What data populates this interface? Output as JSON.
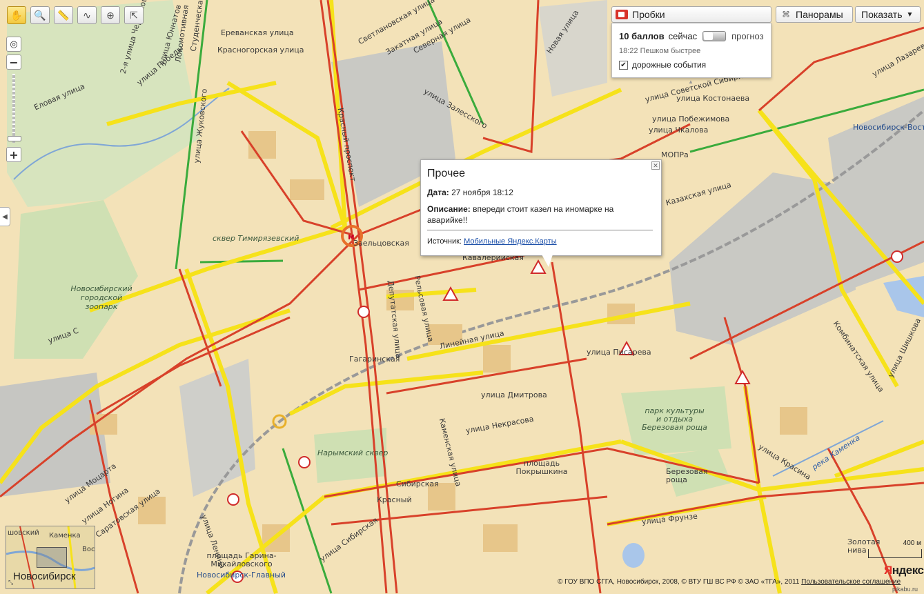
{
  "toolbar": {
    "tools": [
      {
        "icon": "hand-icon",
        "glyph": "✋",
        "active": true
      },
      {
        "icon": "magnifier-icon",
        "glyph": "🔍",
        "active": false
      },
      {
        "icon": "ruler-icon",
        "glyph": "📏",
        "active": false
      },
      {
        "icon": "route-icon",
        "glyph": "∿",
        "active": false
      },
      {
        "icon": "add-marker-icon",
        "glyph": "⊕",
        "active": false
      },
      {
        "icon": "pointer-help-icon",
        "glyph": "⇱",
        "active": false
      }
    ]
  },
  "zoom": {
    "plus": "+",
    "minus": "−",
    "locate": "◎"
  },
  "controls": {
    "traffic_label": "Пробки",
    "panorama_label": "Панорамы",
    "show_label": "Показать",
    "show_arrow": "▼"
  },
  "traffic_panel": {
    "score": "10 баллов",
    "now": "сейчас",
    "forecast": "прогноз",
    "time_note": "18:22 Пешком быстрее",
    "events_label": "дорожные события",
    "events_checked": true
  },
  "popup": {
    "title": "Прочее",
    "date_label": "Дата:",
    "date_value": "27 ноября 18:12",
    "desc_label": "Описание:",
    "desc_value": "впереди стоит казел на иномарке на аварийке!!",
    "source_label": "Источник:",
    "source_link": "Мобильные Яндекс.Карты",
    "close": "✕"
  },
  "map_labels": {
    "yerevanskaya": "Ереванская улица",
    "krasnogorskaya": "Красногорская улица",
    "yelovaya": "Еловая улица",
    "pobedy": "улица Победы",
    "chernyakhovskogo": "2-я улица Черняховского",
    "chernyakh": "улица Черняховского",
    "yunatov": "улица Юннатов",
    "lokomotivnaya": "Локомотивная",
    "studencheskaya": "Студенческая",
    "zhukovskogo": "улица Жуковского",
    "krasny": "Красный проспект",
    "svetlanovskaya": "Светлановская улица",
    "zakatnaya": "Закатная улица",
    "severnaya": "Северная улица",
    "novaya": "Новая улица",
    "zalesskogo": "улица Залесского",
    "sovetskoy": "улица Советской Сибири",
    "kostonaeva": "улица Костонаева",
    "pobezhimova": "улица Побежимова",
    "chkalova": "улица Чкалова",
    "lazareva": "улица Лазарева",
    "novosibirsk_east": "Новосибирск-Восточный",
    "mopra": "МОПРа",
    "kazakh": "Казахская улица",
    "sqver_tim": "сквер Тимирязевский",
    "zoo": "Новосибирский городской зоопарк",
    "zaeltsovskaya": "Заельцовская",
    "deputatskaya": "Депутатская улица",
    "relsovaya": "Рельсовая улица",
    "kavalerijskaya": "Кавалерийская",
    "lineynaya": "Линейная улица",
    "gagarinskaya": "Гагаринская",
    "ulica_s": "улица С",
    "pisareva": "улица Писарева",
    "kombinatskaya": "Комбинатская улица",
    "shishkova": "улица Шишкова",
    "nekrasova": "улица Некрасова",
    "narymsky": "Нарымский сквер",
    "kamenskaya": "Каменская улица",
    "ploshchad": "площадь Покрышкина",
    "park": "парк культуры и отдыха Березовая роща",
    "berezovaya": "Березовая роща",
    "frunze": "улица Фрунзе",
    "krasina": "улица Красина",
    "kamenka": "река Каменка",
    "mozarta": "улица Моцарта",
    "nogina": "улица Ногина",
    "lenina": "улица Ленина",
    "garina": "площадь Гарина-Михайловского",
    "novosib_glav": "Новосибирск-Главный",
    "saratovskaya": "Саратовская улица",
    "sibirskaya": "Сибирская",
    "krasnyy": "Красный",
    "zolotaya_niva": "Золотая нива",
    "glavnaya": "улица Сибирская",
    "dmitrova": "улица Дмитрова"
  },
  "minimap": {
    "city": "Новосибирск",
    "shirokovsky": "шовский",
    "kamenka": "Каменка",
    "vos": "Вос"
  },
  "scale": "400 м",
  "logo": {
    "first": "Я",
    "rest": "ндекс"
  },
  "copyright": "© ГОУ ВПО СГГА, Новосибирск, 2008, © ВТУ ГШ ВС РФ © ЗАО «ТГА», 2011",
  "terms": "Пользовательское соглашение",
  "watermark": "pikabu.ru",
  "colors": {
    "jam": "#d8412a",
    "slow": "#f6e21a",
    "free": "#3aab3c",
    "block": "#f3e2b8",
    "bldg": "#e7c68a",
    "industrial": "#c9c9c4",
    "green": "#cfe0b3",
    "water": "#a9c6ea"
  }
}
